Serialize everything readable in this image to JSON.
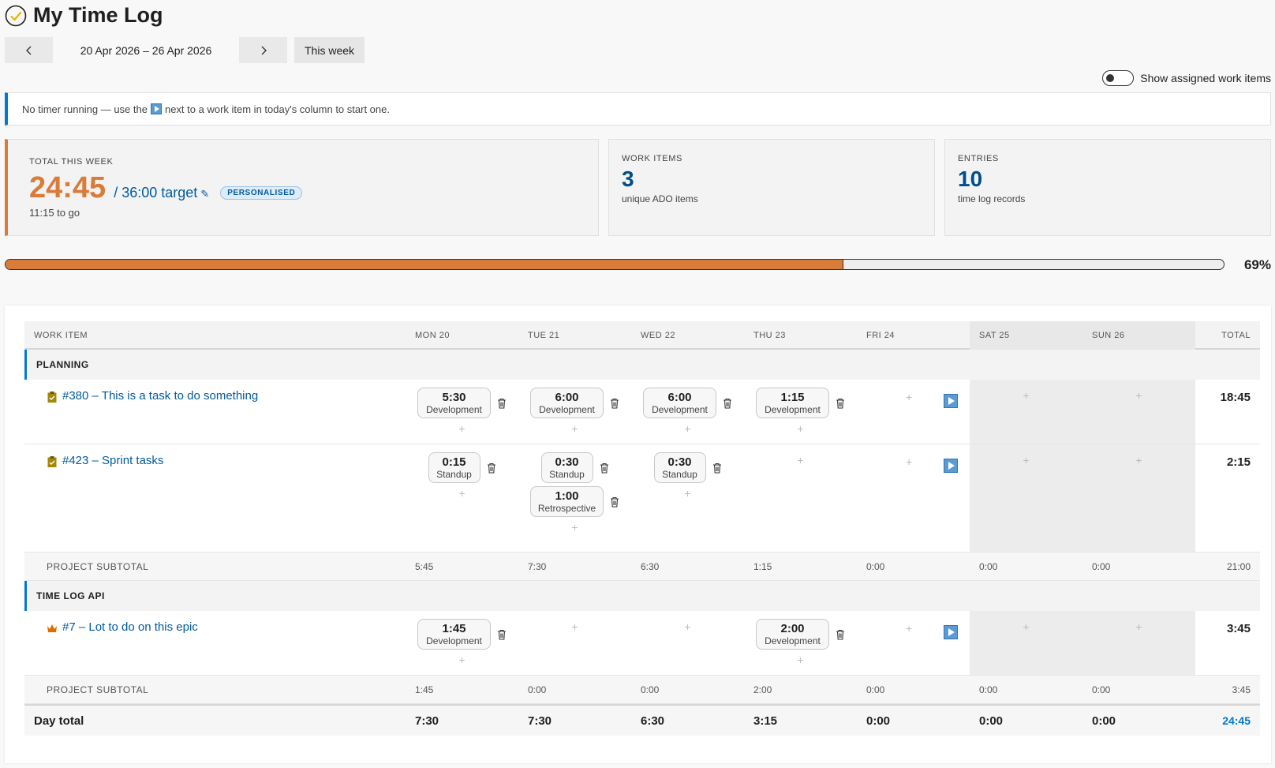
{
  "header": {
    "title": "My Time Log"
  },
  "nav": {
    "date_range": "20 Apr 2026 – 26 Apr 2026",
    "this_week_label": "This week"
  },
  "toggle": {
    "label": "Show assigned work items",
    "on": false
  },
  "info": {
    "before": "No timer running — use the",
    "after": "next to a work item in today's column to start one."
  },
  "summary": {
    "total_label": "TOTAL THIS WEEK",
    "total_value": "24:45",
    "target": "/ 36:00 target",
    "badge": "PERSONALISED",
    "to_go": "11:15 to go",
    "work_items_label": "WORK ITEMS",
    "work_items_value": "3",
    "work_items_sub": "unique ADO items",
    "entries_label": "ENTRIES",
    "entries_value": "10",
    "entries_sub": "time log records"
  },
  "progress": {
    "percent_label": "69%",
    "fraction": 0.6875
  },
  "table": {
    "columns": [
      "WORK ITEM",
      "MON 20",
      "TUE 21",
      "WED 22",
      "THU 23",
      "FRI 24",
      "SAT 25",
      "SUN 26",
      "TOTAL"
    ],
    "groups": [
      {
        "name": "PLANNING",
        "items": [
          {
            "title": "#380 – This is a task to do something",
            "total": "18:45",
            "days": [
              [
                {
                  "time": "5:30",
                  "cat": "Development"
                }
              ],
              [
                {
                  "time": "6:00",
                  "cat": "Development"
                }
              ],
              [
                {
                  "time": "6:00",
                  "cat": "Development"
                }
              ],
              [
                {
                  "time": "1:15",
                  "cat": "Development"
                }
              ],
              [],
              [],
              []
            ]
          },
          {
            "title": "#423 – Sprint tasks",
            "total": "2:15",
            "days": [
              [
                {
                  "time": "0:15",
                  "cat": "Standup"
                }
              ],
              [
                {
                  "time": "0:30",
                  "cat": "Standup"
                },
                {
                  "time": "1:00",
                  "cat": "Retrospective"
                }
              ],
              [
                {
                  "time": "0:30",
                  "cat": "Standup"
                }
              ],
              [],
              [],
              [],
              []
            ]
          }
        ],
        "subtotal_label": "PROJECT SUBTOTAL",
        "subtotals": [
          "5:45",
          "7:30",
          "6:30",
          "1:15",
          "0:00",
          "0:00",
          "0:00",
          "21:00"
        ]
      },
      {
        "name": "TIME LOG API",
        "items": [
          {
            "title": "#7 – Lot to do on this epic",
            "total": "3:45",
            "days": [
              [
                {
                  "time": "1:45",
                  "cat": "Development"
                }
              ],
              [],
              [],
              [
                {
                  "time": "2:00",
                  "cat": "Development"
                }
              ],
              [],
              [],
              []
            ]
          }
        ],
        "subtotal_label": "PROJECT SUBTOTAL",
        "subtotals": [
          "1:45",
          "0:00",
          "0:00",
          "2:00",
          "0:00",
          "0:00",
          "0:00",
          "3:45"
        ]
      }
    ],
    "day_total_label": "Day total",
    "day_totals": [
      "7:30",
      "7:30",
      "6:30",
      "3:15",
      "0:00",
      "0:00",
      "0:00",
      "24:45"
    ]
  },
  "colors": {
    "accent": "#0078d4",
    "orange": "#d97b39",
    "link": "#005a9e"
  }
}
